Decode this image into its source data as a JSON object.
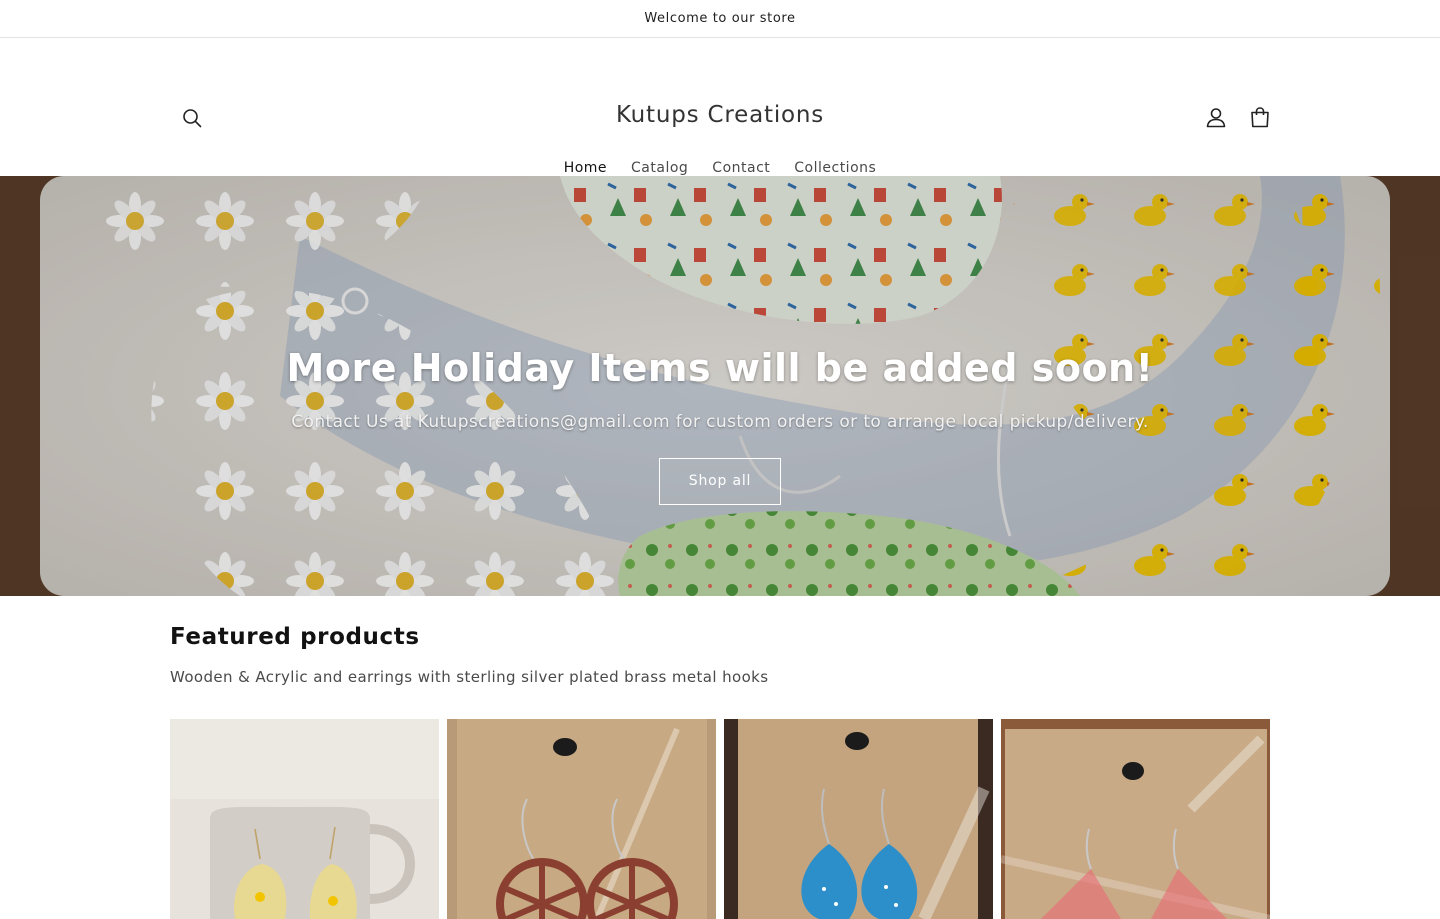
{
  "announcement": {
    "text": "Welcome to our store"
  },
  "header": {
    "store_name": "Kutups Creations",
    "icons": {
      "search": "search-icon",
      "account": "account-icon",
      "cart": "cart-icon"
    }
  },
  "nav": {
    "items": [
      {
        "label": "Home",
        "active": true
      },
      {
        "label": "Catalog",
        "active": false
      },
      {
        "label": "Contact",
        "active": false
      },
      {
        "label": "Collections",
        "active": false
      }
    ]
  },
  "hero": {
    "heading": "More Holiday Items will be added soon!",
    "subheading": "Contact Us at Kutupscreations@gmail.com for custom orders or to arrange local pickup/delivery.",
    "button_label": "Shop all"
  },
  "featured": {
    "title": "Featured products",
    "description": "Wooden & Acrylic and earrings with sterling silver plated brass metal hooks",
    "products": [
      {
        "image": "yellow-duck-acrylic-earrings-on-mug"
      },
      {
        "image": "red-wooden-wheel-earrings-on-card"
      },
      {
        "image": "blue-winter-acrylic-earrings-on-card"
      },
      {
        "image": "pink-acrylic-earrings-on-card"
      }
    ]
  },
  "colors": {
    "text": "#121212",
    "muted": "#4a4a4a",
    "divider": "#e3e3e3"
  }
}
